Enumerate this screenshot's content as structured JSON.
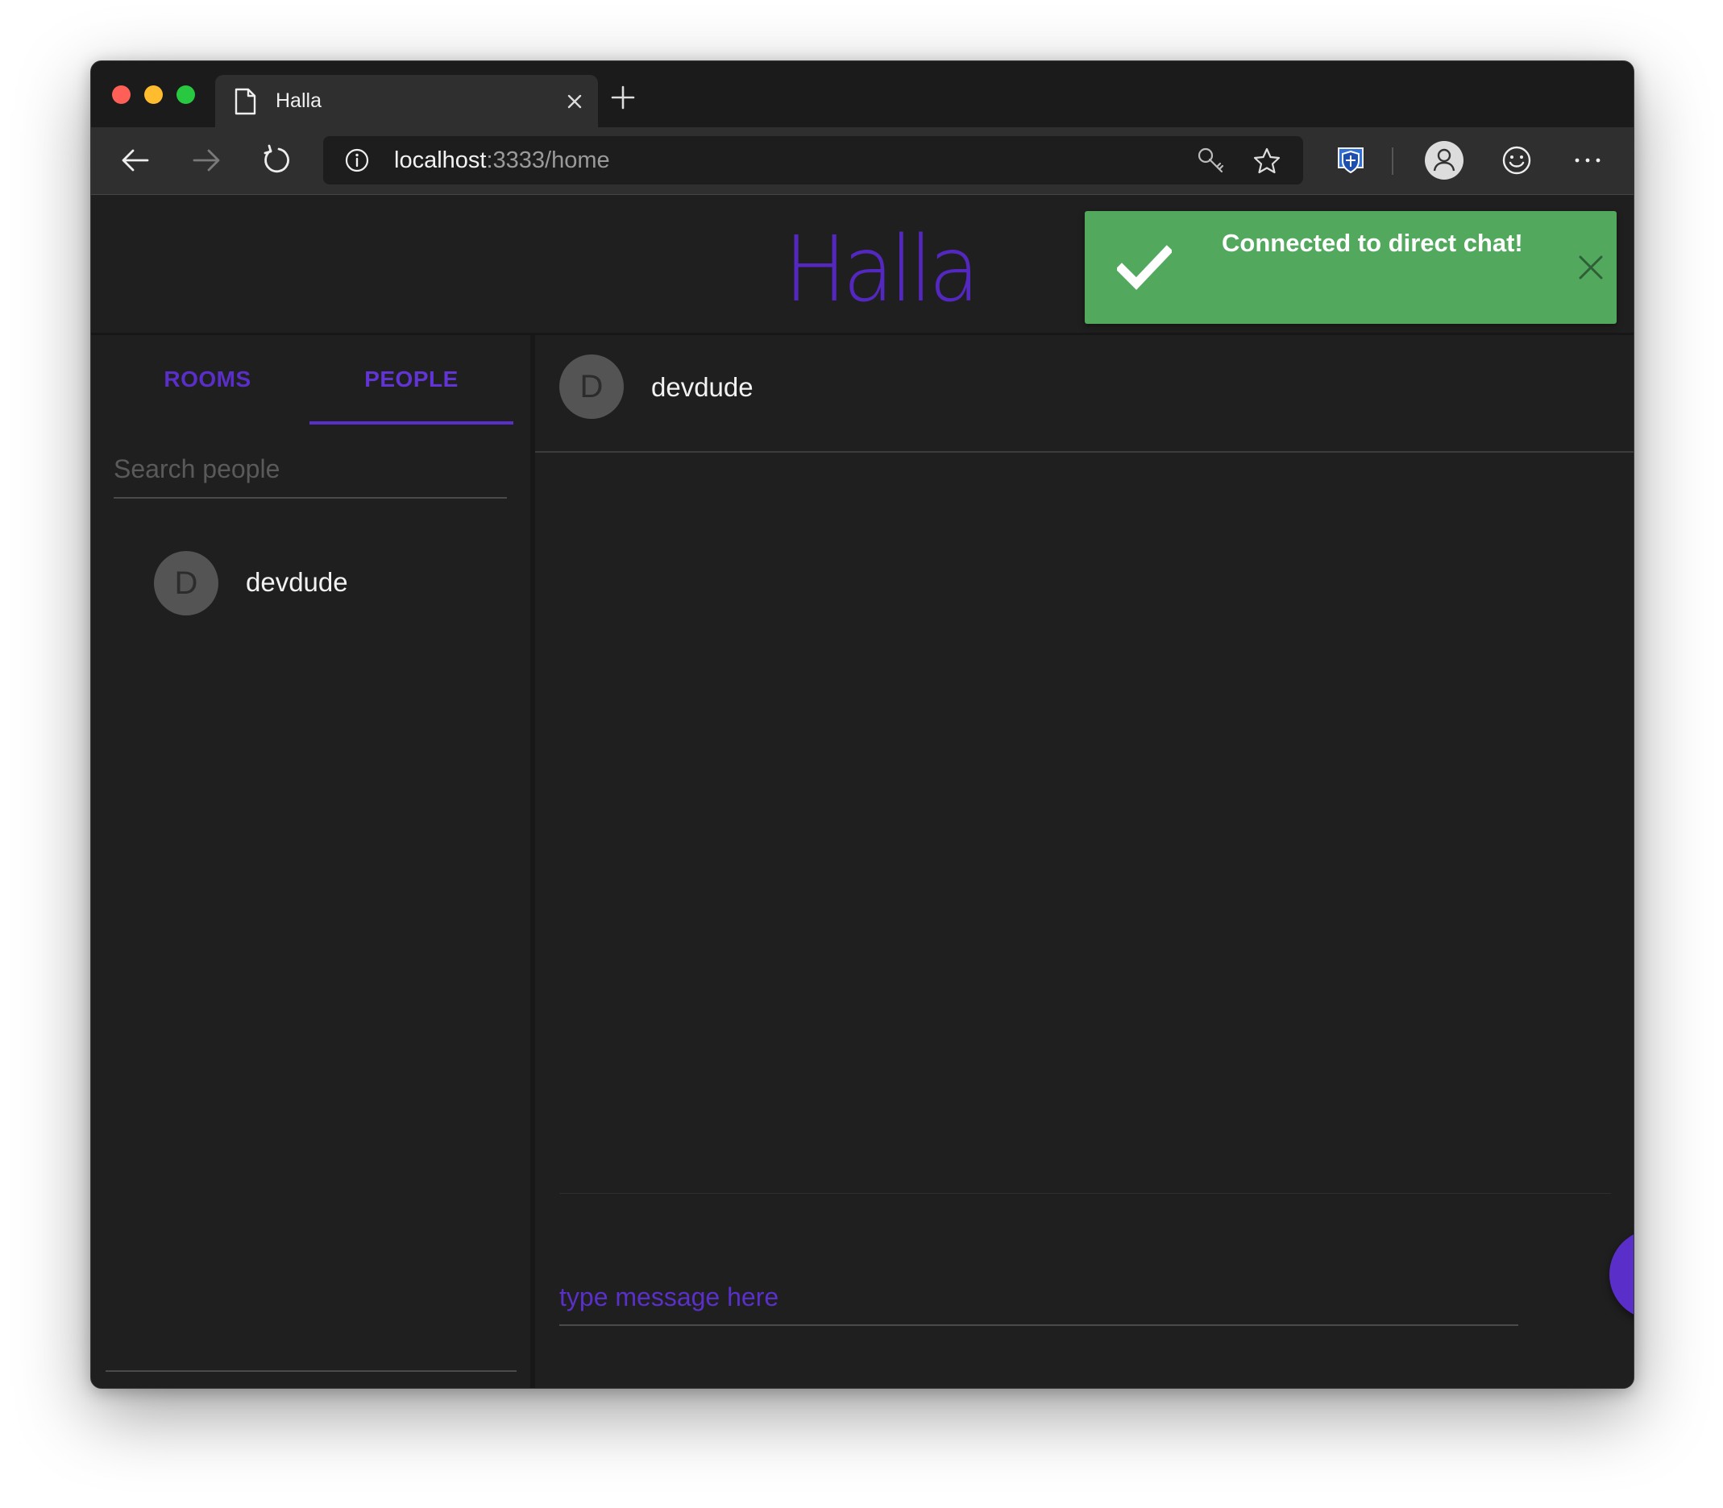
{
  "browser": {
    "tab_title": "Halla",
    "url_host": "localhost",
    "url_path": ":3333/home"
  },
  "app": {
    "logo": "Halla",
    "brand_color": "#5a2fc9"
  },
  "toast": {
    "message": "Connected to direct chat!",
    "color": "#52a95e"
  },
  "sidebar": {
    "tabs": [
      {
        "label": "ROOMS",
        "active": false
      },
      {
        "label": "PEOPLE",
        "active": true
      }
    ],
    "search_placeholder": "Search people",
    "people": [
      {
        "initial": "D",
        "name": "devdude"
      }
    ]
  },
  "chat": {
    "avatar_initial": "D",
    "title": "devdude",
    "input_placeholder": "type message here"
  },
  "icons": {
    "tab": "page-icon",
    "tab_close": "close-icon",
    "new_tab": "plus-icon",
    "back": "arrow-left-icon",
    "forward": "arrow-right-icon",
    "refresh": "refresh-icon",
    "info": "info-icon",
    "key": "key-icon",
    "favorite": "star-icon",
    "shield": "shield-icon",
    "profile": "profile-icon",
    "feedback": "smiley-icon",
    "more": "more-icon",
    "toast_check": "check-icon",
    "toast_close": "close-icon",
    "send": "send-icon"
  }
}
